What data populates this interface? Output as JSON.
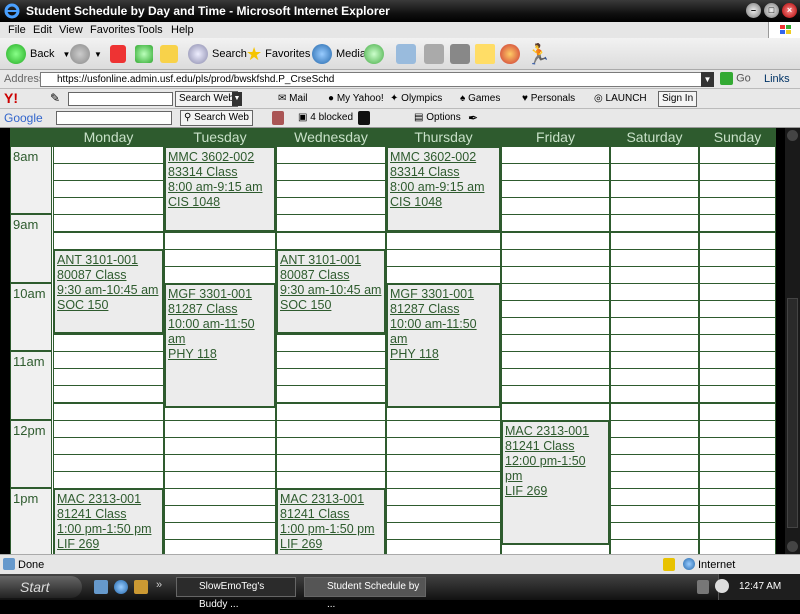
{
  "window": {
    "title": "Student Schedule by Day and Time - Microsoft Internet Explorer",
    "min_label": "–",
    "max_label": "□",
    "close_label": "×"
  },
  "menu": [
    "File",
    "Edit",
    "View",
    "Favorites",
    "Tools",
    "Help"
  ],
  "toolbar": {
    "back": "Back",
    "search": "Search",
    "favorites": "Favorites",
    "media": "Media"
  },
  "address": {
    "label": "Address",
    "url": "https://usfonline.admin.usf.edu/pls/prod/bwskfshd.P_CrseSchd",
    "go": "Go",
    "links": "Links"
  },
  "yahoo": {
    "search_btn": "Search Web",
    "mail": "Mail",
    "my_yahoo": "My Yahoo!",
    "olympics": "Olympics",
    "games": "Games",
    "personals": "Personals",
    "launch": "LAUNCH",
    "sign_in": "Sign In"
  },
  "google": {
    "logo": "Google",
    "search_btn": "Search Web",
    "blocked": "4 blocked",
    "options": "Options"
  },
  "schedule": {
    "days": [
      "Monday",
      "Tuesday",
      "Wednesday",
      "Thursday",
      "Friday",
      "Saturday",
      "Sunday"
    ],
    "times": [
      "8am",
      "9am",
      "10am",
      "11am",
      "12pm",
      "1pm"
    ],
    "courses": [
      {
        "day": "Tuesday",
        "code": "MMC 3602-002",
        "crn": "83314 Class",
        "time": "8:00 am-9:15 am",
        "room": "CIS 1048"
      },
      {
        "day": "Thursday",
        "code": "MMC 3602-002",
        "crn": "83314 Class",
        "time": "8:00 am-9:15 am",
        "room": "CIS 1048"
      },
      {
        "day": "Monday",
        "code": "ANT 3101-001",
        "crn": "80087 Class",
        "time": "9:30 am-10:45 am",
        "room": "SOC 150"
      },
      {
        "day": "Wednesday",
        "code": "ANT 3101-001",
        "crn": "80087 Class",
        "time": "9:30 am-10:45 am",
        "room": "SOC 150"
      },
      {
        "day": "Tuesday",
        "code": "MGF 3301-001",
        "crn": "81287 Class",
        "time": "10:00 am-11:50 am",
        "room": "PHY 118"
      },
      {
        "day": "Thursday",
        "code": "MGF 3301-001",
        "crn": "81287 Class",
        "time": "10:00 am-11:50 am",
        "room": "PHY 118"
      },
      {
        "day": "Friday",
        "code": "MAC 2313-001",
        "crn": "81241 Class",
        "time": "12:00 pm-1:50 pm",
        "room": "LIF 269"
      },
      {
        "day": "Monday",
        "code": "MAC 2313-001",
        "crn": "81241 Class",
        "time": "1:00 pm-1:50 pm",
        "room": "LIF 269"
      },
      {
        "day": "Wednesday",
        "code": "MAC 2313-001",
        "crn": "81241 Class",
        "time": "1:00 pm-1:50 pm",
        "room": "LIF 269"
      }
    ]
  },
  "status": {
    "text": "Done",
    "zone": "Internet"
  },
  "taskbar": {
    "start": "Start",
    "tasks": [
      "SlowEmoTeg's Buddy ...",
      "Student Schedule by ..."
    ],
    "clock": "12:47 AM"
  },
  "colors": {
    "schedule_green": "#2e5b2e",
    "header_text": "#c8e0c8",
    "course_bg": "#ececec"
  }
}
